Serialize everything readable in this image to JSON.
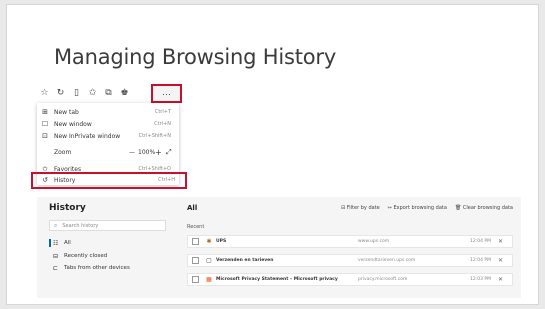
{
  "slide": {
    "title": "Managing Browsing History"
  },
  "toolbar": {
    "icons": [
      "star-outline",
      "refresh",
      "split-screen",
      "favorites",
      "collections",
      "profile"
    ],
    "glyphs": [
      "☆",
      "↻",
      "▯",
      "✩",
      "⧉",
      "♚"
    ],
    "more_label": "···"
  },
  "menu": {
    "items": [
      {
        "icon": "⊞",
        "label": "New tab",
        "shortcut": "Ctrl+T"
      },
      {
        "icon": "☐",
        "label": "New window",
        "shortcut": "Ctrl+N"
      },
      {
        "icon": "⊡",
        "label": "New InPrivate window",
        "shortcut": "Ctrl+Shift+N"
      }
    ],
    "zoom": {
      "label": "Zoom",
      "minus": "—",
      "value": "100%",
      "plus": "+",
      "expand": "⤢"
    },
    "favorites": {
      "icon": "✩",
      "label": "Favorites",
      "shortcut": "Ctrl+Shift+O"
    },
    "history": {
      "icon": "↺",
      "label": "History",
      "shortcut": "Ctrl+H"
    }
  },
  "history_page": {
    "title": "History",
    "search_placeholder": "Search history",
    "nav": [
      {
        "icon": "☷",
        "label": "All"
      },
      {
        "icon": "⊟",
        "label": "Recently closed"
      },
      {
        "icon": "⊏",
        "label": "Tabs from other devices"
      }
    ],
    "main_title": "All",
    "actions": {
      "filter": "Filter by date",
      "export": "Export browsing data",
      "clear": "Clear browsing data"
    },
    "section": "Recent",
    "rows": [
      {
        "favicon": "✱",
        "title": "UPS",
        "url": "www.ups.com",
        "time": "12:04 PM"
      },
      {
        "favicon": "▢",
        "title": "Verzenden en tarieven",
        "url": "verzendtarieven.ups.com",
        "time": "12:04 PM"
      },
      {
        "favicon": "▦",
        "title": "Microsoft Privacy Statement – Microsoft privacy",
        "url": "privacy.microsoft.com",
        "time": "12:03 PM"
      }
    ]
  },
  "colors": {
    "highlight": "#c8102e",
    "accent": "#0067b8"
  }
}
